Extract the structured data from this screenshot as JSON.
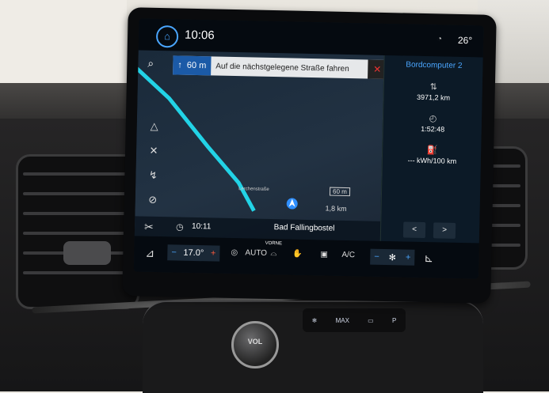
{
  "status": {
    "time": "10:06",
    "outside_temp": "26°",
    "wifi_icon": "wifi-icon"
  },
  "nav": {
    "distance": "60 m",
    "instruction": "Auf die nächstgelegene Straße fahren",
    "street_label": "Lerchenstraße",
    "scale": "60 m",
    "remaining": "1,8 km",
    "eta": "10:11",
    "destination": "Bad Fallingbostel"
  },
  "panel": {
    "title": "Bordcomputer 2",
    "distance": "3971,2 km",
    "duration": "1:52:48",
    "consumption": "--- kWh/100 km",
    "prev": "<",
    "next": ">"
  },
  "climate": {
    "temp_left": "17.0°",
    "minus": "−",
    "plus": "+",
    "auto": "AUTO",
    "vorne": "VORNE",
    "ac": "A/C",
    "fan_minus": "−",
    "fan_plus": "+"
  },
  "hardware": {
    "vol_label": "VOL",
    "max_label": "MAX"
  },
  "colors": {
    "accent_blue": "#4aa6ff",
    "route_cyan": "#22d3e6",
    "heat_red": "#ff5a3c"
  }
}
